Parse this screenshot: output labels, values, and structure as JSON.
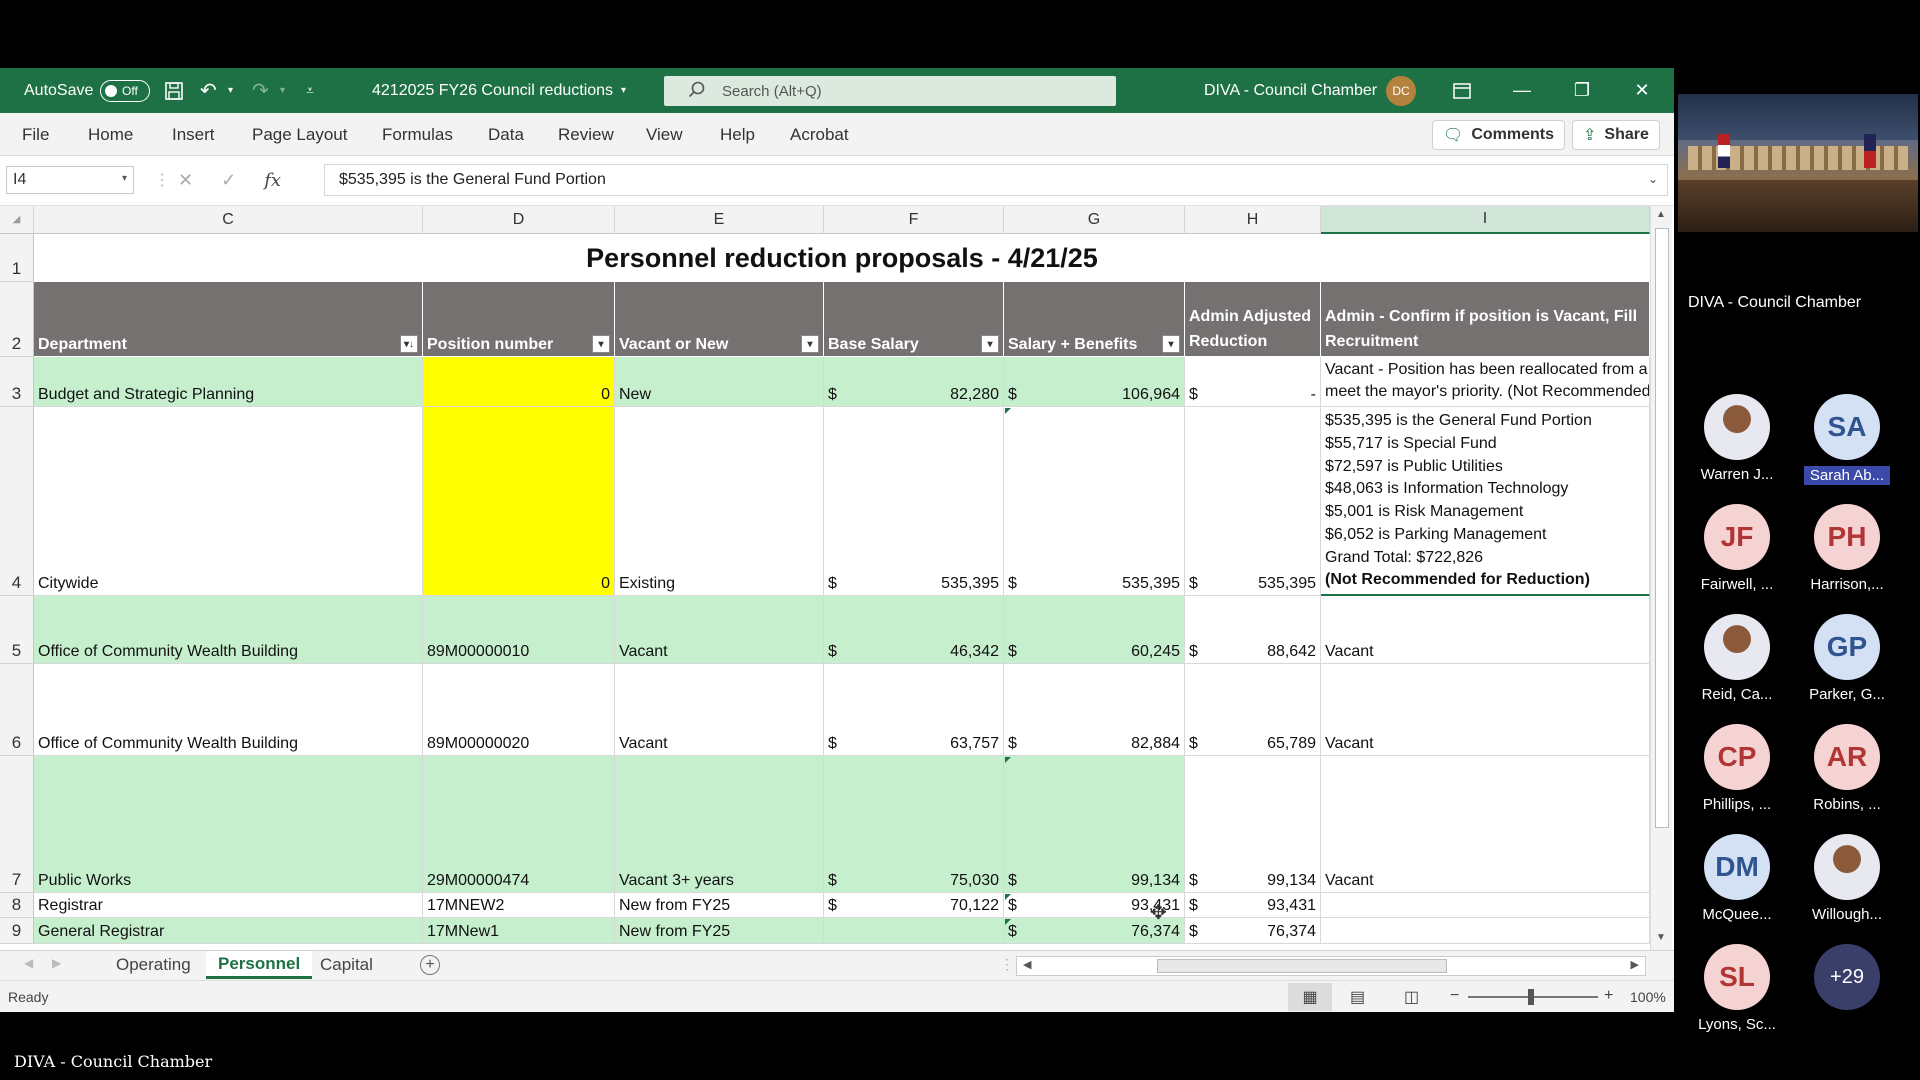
{
  "titlebar": {
    "autosave_label": "AutoSave",
    "autosave_state": "Off",
    "file_name": "4212025 FY26 Council reductions",
    "search_placeholder": "Search (Alt+Q)",
    "account_name": "DIVA - Council Chamber",
    "account_initials": "DC"
  },
  "menu": {
    "items": [
      "File",
      "Home",
      "Insert",
      "Page Layout",
      "Formulas",
      "Data",
      "Review",
      "View",
      "Help",
      "Acrobat"
    ],
    "comments_label": "Comments",
    "share_label": "Share"
  },
  "formula_bar": {
    "cell_ref": "I4",
    "formula": "$535,395 is the General Fund Portion"
  },
  "columns": [
    "C",
    "D",
    "E",
    "F",
    "G",
    "H",
    "I"
  ],
  "sheet": {
    "title": "Personnel reduction proposals - 4/21/25",
    "headers": {
      "department": "Department",
      "position": "Position number",
      "vacant": "Vacant or New",
      "base": "Base Salary",
      "salary_benefits": "Salary + Benefits",
      "admin_adjusted_1": "Admin Adjusted",
      "admin_adjusted_2": "Reduction",
      "admin_confirm_1": "Admin - Confirm if position is Vacant, Fill",
      "admin_confirm_2": "Recruitment"
    },
    "rows": [
      {
        "num": "3",
        "department": "Budget and Strategic Planning",
        "position": "0",
        "vacant": "New",
        "base": "82,280",
        "sb": "106,964",
        "adj": "-",
        "confirm_lines": [
          "Vacant - Position has been reallocated from a n",
          "meet the mayor's priority. (Not Recommended"
        ]
      },
      {
        "num": "4",
        "department": "Citywide",
        "position": "0",
        "vacant": "Existing",
        "base": "535,395",
        "sb": "535,395",
        "adj": "535,395",
        "confirm_lines": [
          "$535,395 is the General Fund Portion",
          "$55,717 is Special Fund",
          "$72,597 is Public Utilities",
          "$48,063 is Information Technology",
          "$5,001 is Risk Management",
          "$6,052 is Parking Management",
          "Grand Total: $722,826",
          "(Not Recommended for Reduction)"
        ]
      },
      {
        "num": "5",
        "department": "Office of Community Wealth Building",
        "position": "89M00000010",
        "vacant": "Vacant",
        "base": "46,342",
        "sb": "60,245",
        "adj": "88,642",
        "confirm_lines": [
          "Vacant"
        ]
      },
      {
        "num": "6",
        "department": "Office of Community Wealth Building",
        "position": "89M00000020",
        "vacant": "Vacant",
        "base": "63,757",
        "sb": "82,884",
        "adj": "65,789",
        "confirm_lines": [
          "Vacant"
        ]
      },
      {
        "num": "7",
        "department": "Public Works",
        "position": "29M00000474",
        "vacant": "Vacant 3+ years",
        "base": "75,030",
        "sb": "99,134",
        "adj": "99,134",
        "confirm_lines": [
          "Vacant"
        ]
      },
      {
        "num": "8",
        "department": "Registrar",
        "position": "17MNEW2",
        "vacant": "New from FY25",
        "base": "70,122",
        "sb": "93,431",
        "adj": "93,431",
        "confirm_lines": [
          ""
        ]
      },
      {
        "num": "9",
        "department": "General Registrar",
        "position": "17MNew1",
        "vacant": "New from FY25",
        "base": "",
        "sb": "76,374",
        "adj": "76,374",
        "confirm_lines": [
          ""
        ]
      }
    ],
    "currency": "$",
    "row_labels": [
      "1",
      "2"
    ]
  },
  "tabs": [
    "Operating",
    "Personnel",
    "Capital"
  ],
  "active_tab": "Personnel",
  "status": {
    "ready": "Ready",
    "zoom": "100%"
  },
  "meeting": {
    "video_label": "DIVA - Council Chamber",
    "participants": [
      {
        "initials": "",
        "name": "Warren J...",
        "style": "photo"
      },
      {
        "initials": "SA",
        "name": "Sarah Ab...",
        "style": "blue",
        "highlight": true
      },
      {
        "initials": "JF",
        "name": "Fairwell, ...",
        "style": "pink"
      },
      {
        "initials": "PH",
        "name": "Harrison,...",
        "style": "pink"
      },
      {
        "initials": "",
        "name": "Reid, Ca...",
        "style": "photo"
      },
      {
        "initials": "GP",
        "name": "Parker, G...",
        "style": "blue"
      },
      {
        "initials": "CP",
        "name": "Phillips, ...",
        "style": "pink"
      },
      {
        "initials": "AR",
        "name": "Robins, ...",
        "style": "pink"
      },
      {
        "initials": "DM",
        "name": "McQuee...",
        "style": "blue"
      },
      {
        "initials": "",
        "name": "Willough...",
        "style": "photo"
      },
      {
        "initials": "SL",
        "name": "Lyons, Sc...",
        "style": "pink"
      },
      {
        "initials": "+29",
        "name": "",
        "style": "navy"
      }
    ]
  },
  "caption": "DIVA - Council Chamber",
  "colors": {
    "excel_green": "#1e7145",
    "green_fill": "#c6efce",
    "yellow_fill": "#ffff00",
    "header_gray": "#767171"
  }
}
